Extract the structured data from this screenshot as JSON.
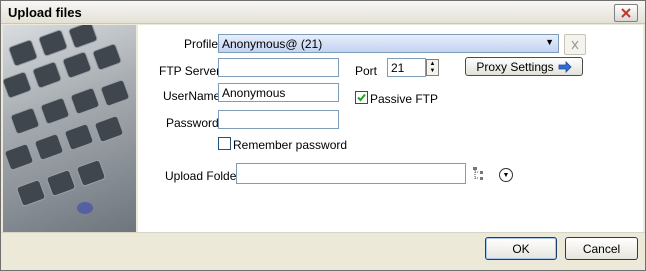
{
  "window": {
    "title": "Upload files"
  },
  "form": {
    "profile_label": "Profile",
    "profile_value": "Anonymous@ (21)",
    "ftp_server_label": "FTP Server",
    "ftp_server_value": "",
    "port_label": "Port",
    "port_value": "21",
    "proxy_settings_label": "Proxy Settings",
    "username_label": "UserName",
    "username_value": "Anonymous",
    "passive_ftp_label": "Passive FTP",
    "passive_ftp_checked": true,
    "password_label": "Password",
    "password_value": "",
    "remember_password_label": "Remember password",
    "remember_password_checked": false,
    "upload_folder_label": "Upload Folder",
    "upload_folder_value": ""
  },
  "footer": {
    "ok_label": "OK",
    "cancel_label": "Cancel"
  },
  "icons": {
    "close": "close-icon",
    "delete_profile": "delete-profile-icon",
    "proxy_arrow": "arrow-right-icon",
    "folder_tree": "folder-tree-icon",
    "expand": "chevron-down-circle-icon"
  },
  "colors": {
    "accent_blue": "#316ac5",
    "panel_bg": "#ece9d8",
    "field_border": "#7f9db9"
  }
}
